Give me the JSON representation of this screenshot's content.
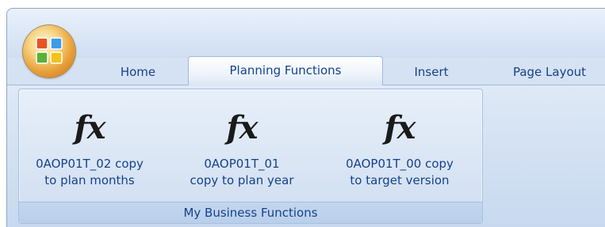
{
  "office_button": {
    "icon": "office-logo-icon"
  },
  "tabs": [
    {
      "label": "Home",
      "active": false
    },
    {
      "label": "Planning Functions",
      "active": true
    },
    {
      "label": "Insert",
      "active": false
    },
    {
      "label": "Page Layout",
      "active": false
    }
  ],
  "group": {
    "caption": "My Business Functions",
    "buttons": [
      {
        "icon": "function-fx-icon",
        "label": "0AOP01T_02 copy\nto plan months"
      },
      {
        "icon": "function-fx-icon",
        "label": "0AOP01T_01\ncopy to plan year"
      },
      {
        "icon": "function-fx-icon",
        "label": "0AOP01T_00 copy\nto target version"
      }
    ]
  }
}
